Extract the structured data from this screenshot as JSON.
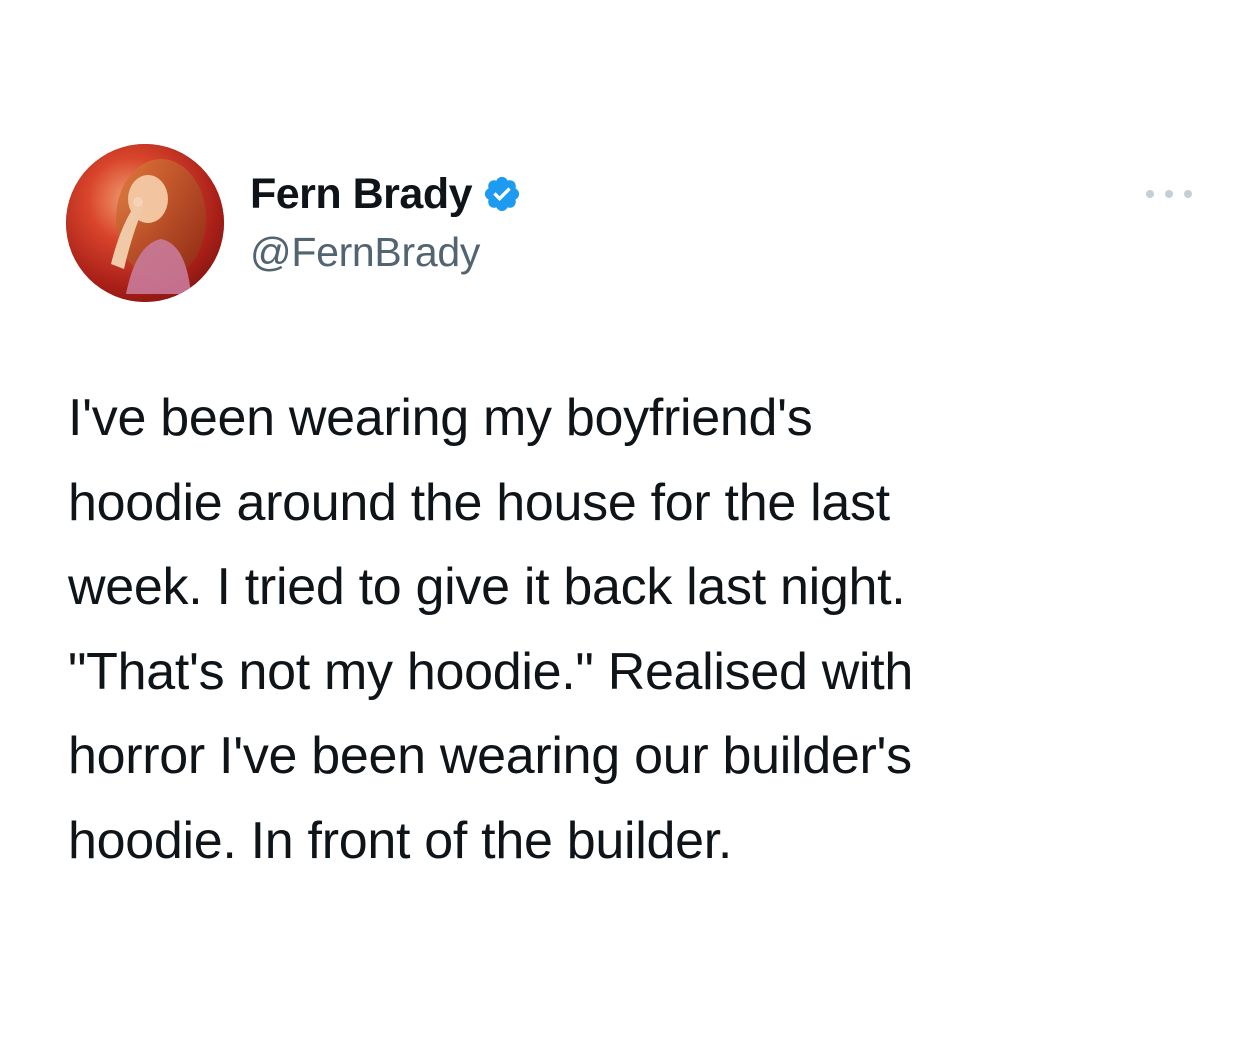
{
  "author": {
    "display_name": "Fern Brady",
    "handle": "@FernBrady",
    "verified": true,
    "avatar_icon": "profile-photo",
    "verified_icon": "verified-badge-icon",
    "verified_color": "#1d9bf0"
  },
  "menu": {
    "icon": "more-options-icon"
  },
  "tweet": {
    "lines": [
      "I've been wearing my boyfriend's",
      "hoodie around the house for the last",
      "week. I tried to give it back last night.",
      "\"That's not my hoodie.\" Realised with",
      "horror I've been wearing our builder's",
      "hoodie. In front of the builder."
    ]
  }
}
